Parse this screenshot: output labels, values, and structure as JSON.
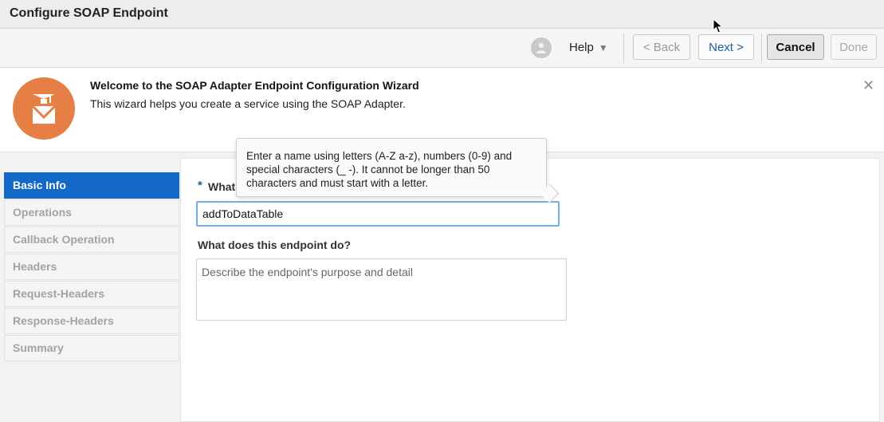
{
  "window": {
    "title": "Configure SOAP Endpoint"
  },
  "toolbar": {
    "help_label": "Help",
    "back_label": "< Back",
    "next_label": "Next >",
    "cancel_label": "Cancel",
    "done_label": "Done"
  },
  "welcome": {
    "title": "Welcome to the SOAP Adapter Endpoint Configuration Wizard",
    "description": "This wizard helps you create a service using the SOAP Adapter.",
    "accent_color": "#e57f46"
  },
  "nav": {
    "items": [
      {
        "label": "Basic Info",
        "active": true
      },
      {
        "label": "Operations"
      },
      {
        "label": "Callback Operation"
      },
      {
        "label": "Headers"
      },
      {
        "label": "Request-Headers"
      },
      {
        "label": "Response-Headers"
      },
      {
        "label": "Summary"
      }
    ],
    "active_color": "#1468c8"
  },
  "form": {
    "required_marker": "*",
    "name_label": "What",
    "name_value": "addToDataTable",
    "description_label": "What does this endpoint do?",
    "description_placeholder": "Describe the endpoint's purpose and detail",
    "description_value": ""
  },
  "tooltip": {
    "text": "Enter a name using letters (A-Z a-z), numbers (0-9) and special characters (_ -). It cannot be longer than 50 characters and must start with a letter."
  }
}
